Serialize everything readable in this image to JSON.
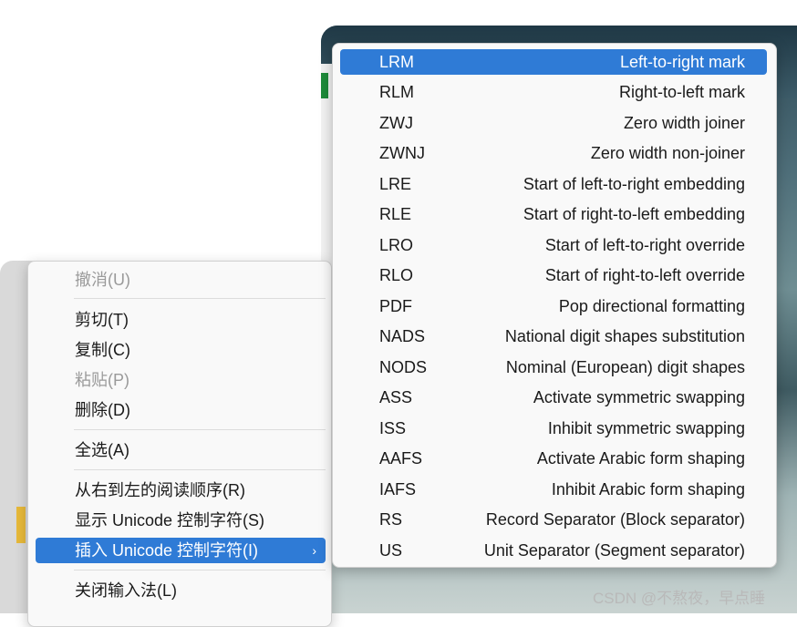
{
  "context_menu": {
    "items": [
      {
        "label": "撤消(U)",
        "state": "disabled"
      },
      {
        "label": "剪切(T)",
        "state": "normal"
      },
      {
        "label": "复制(C)",
        "state": "normal"
      },
      {
        "label": "粘贴(P)",
        "state": "disabled"
      },
      {
        "label": "删除(D)",
        "state": "normal"
      },
      {
        "label": "全选(A)",
        "state": "normal"
      },
      {
        "label": "从右到左的阅读顺序(R)",
        "state": "normal"
      },
      {
        "label": "显示 Unicode 控制字符(S)",
        "state": "normal"
      },
      {
        "label": "插入 Unicode 控制字符(I)",
        "state": "highlighted",
        "submenu_glyph": "›"
      },
      {
        "label": "关闭输入法(L)",
        "state": "normal"
      }
    ]
  },
  "submenu": {
    "items": [
      {
        "code": "LRM",
        "desc": "Left-to-right mark",
        "state": "highlighted"
      },
      {
        "code": "RLM",
        "desc": "Right-to-left mark"
      },
      {
        "code": "ZWJ",
        "desc": "Zero width joiner"
      },
      {
        "code": "ZWNJ",
        "desc": "Zero width non-joiner"
      },
      {
        "code": "LRE",
        "desc": "Start of left-to-right embedding"
      },
      {
        "code": "RLE",
        "desc": "Start of right-to-left embedding"
      },
      {
        "code": "LRO",
        "desc": "Start of left-to-right override"
      },
      {
        "code": "RLO",
        "desc": "Start of right-to-left override"
      },
      {
        "code": "PDF",
        "desc": "Pop directional formatting"
      },
      {
        "code": "NADS",
        "desc": "National digit shapes substitution"
      },
      {
        "code": "NODS",
        "desc": "Nominal (European) digit shapes"
      },
      {
        "code": "ASS",
        "desc": "Activate symmetric swapping"
      },
      {
        "code": "ISS",
        "desc": "Inhibit symmetric swapping"
      },
      {
        "code": "AAFS",
        "desc": "Activate Arabic form shaping"
      },
      {
        "code": "IAFS",
        "desc": "Inhibit Arabic form shaping"
      },
      {
        "code": "RS",
        "desc": "Record Separator (Block separator)"
      },
      {
        "code": "US",
        "desc": "Unit Separator (Segment separator)"
      }
    ]
  },
  "watermark": "CSDN @不熬夜，早点睡",
  "colors": {
    "highlight": "#2f7bd6",
    "menu_bg": "#f9f9f9",
    "disabled_text": "#9a9a9a"
  }
}
